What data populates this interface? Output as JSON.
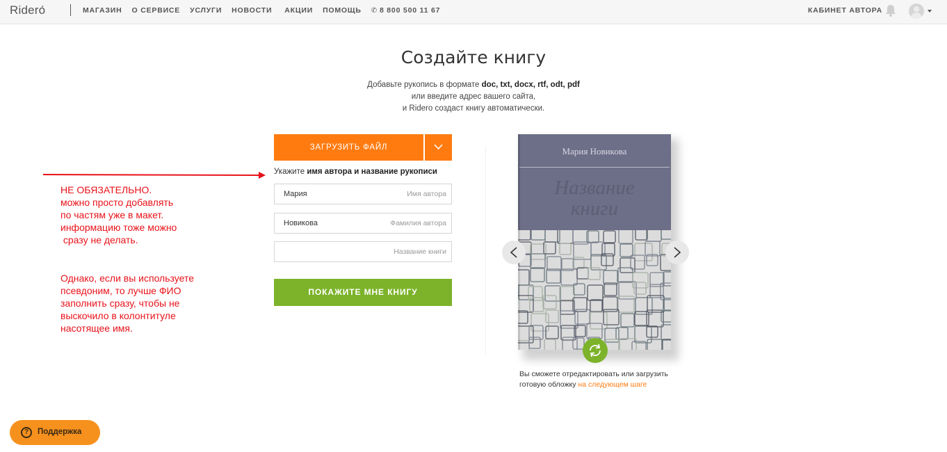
{
  "header": {
    "logo": "Riderо́",
    "nav": [
      "МАГАЗИН",
      "О СЕРВИСЕ",
      "УСЛУГИ",
      "НОВОСТИ",
      "АКЦИИ",
      "ПОМОЩЬ"
    ],
    "phone": "8 800 500 11 67",
    "cabinet": "КАБИНЕТ АВТОРА"
  },
  "main": {
    "title": "Создайте книгу",
    "subtitle_line1_prefix": "Добавьте рукопись в формате ",
    "subtitle_line1_formats": "doc, txt, docx, rtf, odt, pdf",
    "subtitle_line2": "или введите адрес вашего сайта,",
    "subtitle_line3": "и Ridero создаст книгу автоматически."
  },
  "form": {
    "upload_label": "ЗАГРУЗИТЬ ФАЙЛ",
    "hint_prefix": "Укажите ",
    "hint_bold": "имя автора и название рукописи",
    "fields": [
      {
        "value": "Мария",
        "placeholder": "Имя автора"
      },
      {
        "value": "Новикова",
        "placeholder": "Фамилия автора"
      },
      {
        "value": "",
        "placeholder": "Название книги"
      }
    ],
    "submit_label": "ПОКАЖИТЕ МНЕ КНИГУ"
  },
  "annotation": {
    "note1": [
      "НЕ ОБЯЗАТЕЛЬНО.",
      "можно просто добавлять",
      "по частям уже в макет.",
      "информацию тоже можно",
      " сразу не делать."
    ],
    "note2": [
      "Однако, если вы используете",
      "псевдоним, то лучше ФИО",
      "заполнить сразу, чтобы не",
      "выскочило в колонтитуле",
      "насотящее имя."
    ],
    "color": "#e8121a"
  },
  "book": {
    "author": "Мария Новикова",
    "title_line1": "Название",
    "title_line2": "книги",
    "cover_color": "#6d6e87",
    "note_text": "Вы сможете отредактировать или загрузить готовую обложку ",
    "note_link": "на следующем шаге"
  },
  "support": {
    "label": "Поддержка"
  },
  "colors": {
    "accent": "#ff7b10",
    "green": "#7cb32a",
    "support": "#f7911e"
  }
}
